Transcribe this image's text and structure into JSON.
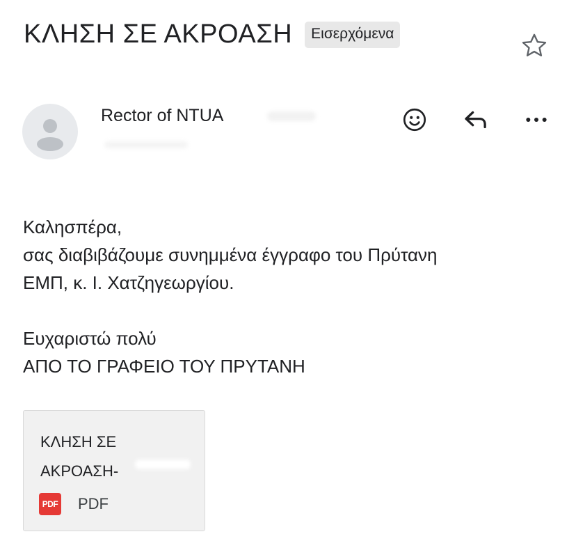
{
  "email": {
    "subject": "ΚΛΗΣΗ ΣΕ ΑΚΡΟΑΣΗ",
    "label": "Εισερχόμενα",
    "sender_name": "Rector of NTUA",
    "body_lines": [
      "Καλησπέρα,",
      "σας διαβιβάζουμε συνημμένα έγγραφο του Πρύτανη",
      "ΕΜΠ, κ. Ι. Χατζηγεωργίου.",
      "Ευχαριστώ πολύ",
      "ΑΠΟ ΤΟ ΓΡΑΦΕΙΟ ΤΟΥ ΠΡΥΤΑΝΗ"
    ]
  },
  "attachment": {
    "name_line1": "ΚΛΗΣΗ ΣΕ",
    "name_line2": "ΑΚΡΟΑΣΗ-",
    "icon_text": "PDF",
    "type_label": "PDF"
  },
  "icons": {
    "star": "star-outline-icon",
    "avatar": "default-avatar-icon",
    "emoji": "add-reaction-icon",
    "reply": "reply-icon",
    "more": "more-horizontal-icon"
  },
  "colors": {
    "pdf_red": "#e53935",
    "label_chip_bg": "#e8e8e8",
    "avatar_bg": "#e8eaed"
  }
}
